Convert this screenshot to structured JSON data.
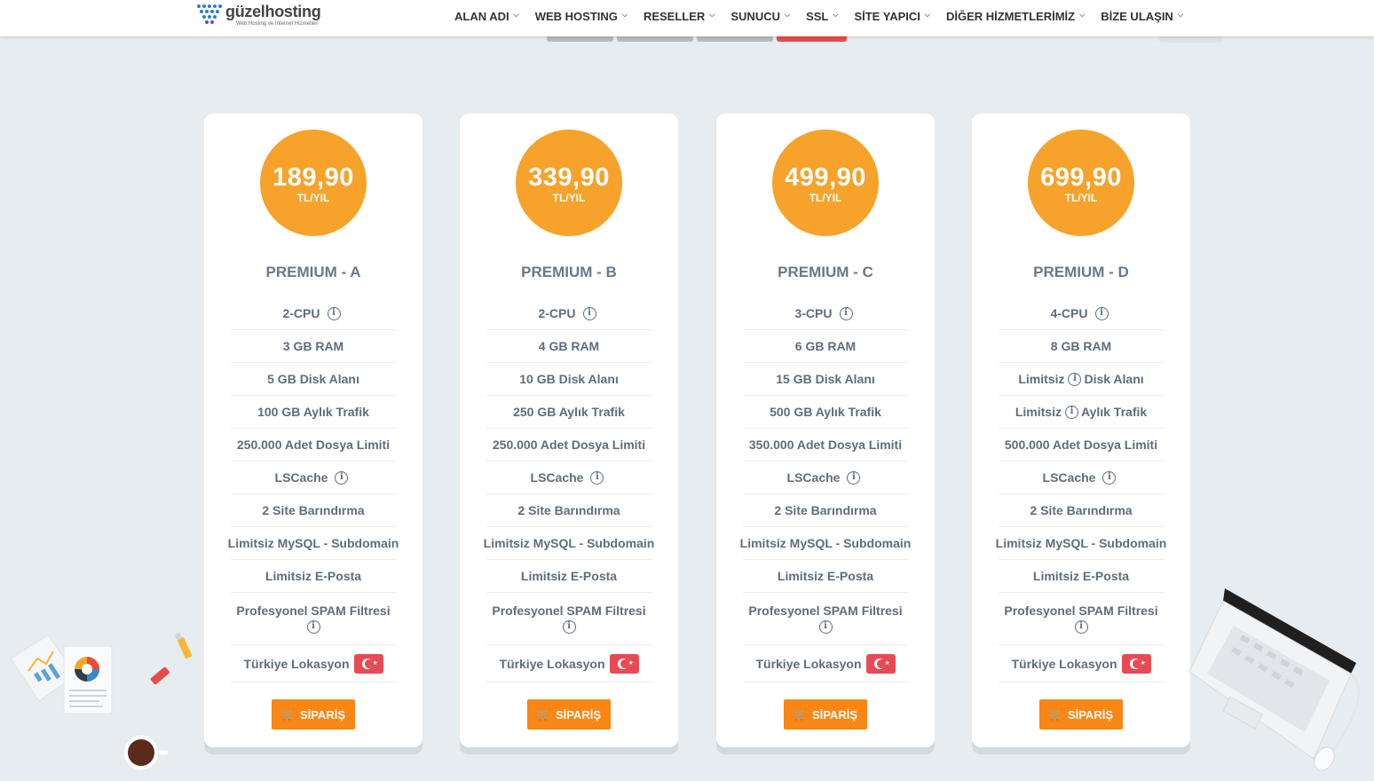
{
  "header": {
    "logo_name": "güzelhosting",
    "logo_tagline": "Web Hosting ve İnternet Hizmetleri",
    "nav": [
      "ALAN ADI",
      "WEB HOSTING",
      "RESELLER",
      "SUNUCU",
      "SSL",
      "SİTE YAPICI",
      "DİĞER HİZMETLERİMİZ",
      "BİZE ULAŞIN"
    ]
  },
  "colors": {
    "price_circle": "#f7a22b",
    "order_button": "#f98615",
    "flag": "#e84a55",
    "background": "#e6ecef"
  },
  "plans": [
    {
      "price": "189,90",
      "unit": "TL/YIL",
      "name": "PREMIUM - A",
      "cpu": "2-CPU",
      "ram": "3 GB RAM",
      "disk": "5 GB Disk Alanı",
      "traffic": "100 GB Aylık Trafik",
      "files": "250.000 Adet Dosya Limiti",
      "cache": "LSCache",
      "sites": "2 Site Barındırma",
      "mysql": "Limitsiz MySQL - Subdomain",
      "email": "Limitsiz E-Posta",
      "spam": "Profesyonel SPAM Filtresi",
      "location": "Türkiye Lokasyon",
      "order": "SİPARİŞ"
    },
    {
      "price": "339,90",
      "unit": "TL/YIL",
      "name": "PREMIUM - B",
      "cpu": "2-CPU",
      "ram": "4 GB RAM",
      "disk": "10 GB Disk Alanı",
      "traffic": "250 GB Aylık Trafik",
      "files": "250.000 Adet Dosya Limiti",
      "cache": "LSCache",
      "sites": "2 Site Barındırma",
      "mysql": "Limitsiz MySQL - Subdomain",
      "email": "Limitsiz E-Posta",
      "spam": "Profesyonel SPAM Filtresi",
      "location": "Türkiye Lokasyon",
      "order": "SİPARİŞ"
    },
    {
      "price": "499,90",
      "unit": "TL/YIL",
      "name": "PREMIUM - C",
      "cpu": "3-CPU",
      "ram": "6 GB RAM",
      "disk": "15 GB Disk Alanı",
      "traffic": "500 GB Aylık Trafik",
      "files": "350.000 Adet Dosya Limiti",
      "cache": "LSCache",
      "sites": "2 Site Barındırma",
      "mysql": "Limitsiz MySQL - Subdomain",
      "email": "Limitsiz E-Posta",
      "spam": "Profesyonel SPAM Filtresi",
      "location": "Türkiye Lokasyon",
      "order": "SİPARİŞ"
    },
    {
      "price": "699,90",
      "unit": "TL/YIL",
      "name": "PREMIUM - D",
      "cpu": "4-CPU",
      "ram": "8 GB RAM",
      "disk_prefix": "Limitsiz",
      "disk_suffix": "Disk Alanı",
      "traffic_prefix": "Limitsiz",
      "traffic_suffix": "Aylık Trafik",
      "files": "500.000 Adet Dosya Limiti",
      "cache": "LSCache",
      "sites": "2 Site Barındırma",
      "mysql": "Limitsiz MySQL - Subdomain",
      "email": "Limitsiz E-Posta",
      "spam": "Profesyonel SPAM Filtresi",
      "location": "Türkiye Lokasyon",
      "order": "SİPARİŞ"
    }
  ]
}
